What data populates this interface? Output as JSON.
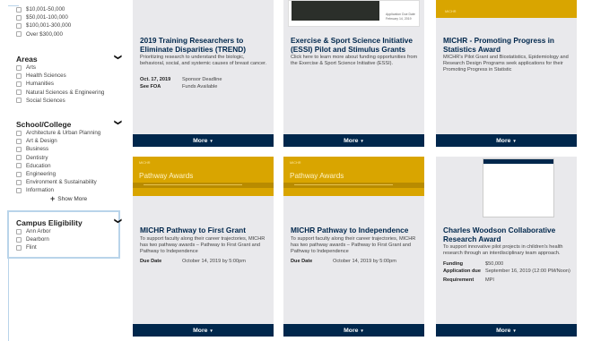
{
  "sidebar": {
    "amounts": [
      "$10,001-50,000",
      "$50,001-100,000",
      "$100,001-300,000",
      "Over $300,000"
    ],
    "areas": {
      "title": "Areas",
      "items": [
        "Arts",
        "Health Sciences",
        "Humanities",
        "Natural Sciences & Engineering",
        "Social Sciences"
      ]
    },
    "school": {
      "title": "School/College",
      "items": [
        "Architecture & Urban Planning",
        "Art & Design",
        "Business",
        "Dentistry",
        "Education",
        "Engineering",
        "Environment & Sustainability",
        "Information"
      ],
      "show_more": "Show More"
    },
    "campus": {
      "title": "Campus Eligibility",
      "items": [
        "Ann Arbor",
        "Dearborn",
        "Flint"
      ]
    }
  },
  "cards": [
    {
      "title": "2019 Training Researchers to Eliminate Disparities (TREND)",
      "desc": "Prioritizing research to understand the biologic, behavioral, social, and systemic causes of breast cancer.",
      "meta": [
        [
          "Oct. 17, 2019",
          "Sponsor Deadline"
        ],
        [
          "See FOA",
          "Funds Available"
        ]
      ],
      "more": "More"
    },
    {
      "title": "Exercise & Sport Science Initiative (ESSI) Pilot and Stimulus Grants",
      "desc": "Click here to learn more about funding opportunities from the Exercise & Sport Science Initiative (ESSI).",
      "thumb_caption": "Application Due Date\nFebruary 14, 2019",
      "more": "More"
    },
    {
      "title": "MICHR - Promoting Progress in Statistics Award",
      "desc": "MICHR's Pilot Grant and Biostatistics, Epidemiology and Research Design Programs seek applications for their Promoting Progress in Statistic",
      "more": "More"
    },
    {
      "banner_small": "MICHR",
      "banner_big": "Pathway Awards",
      "title": "MICHR Pathway to First Grant",
      "desc": "To support faculty along their career trajectories, MICHR has two pathway awards – Pathway to First Grant and Pathway to Independence",
      "meta": [
        [
          "Due Date",
          "October 14, 2019 by 5:00pm"
        ]
      ],
      "more": "More"
    },
    {
      "banner_small": "MICHR",
      "banner_big": "Pathway Awards",
      "title": "MICHR Pathway to Independence",
      "desc": "To support faculty along their career trajectories, MICHR has two pathway awards – Pathway to First Grant and Pathway to Independence",
      "meta": [
        [
          "Due Date",
          "October 14, 2019 by 5:00pm"
        ]
      ],
      "more": "More"
    },
    {
      "title": "Charles Woodson Collaborative Research Award",
      "desc": "To support innovative pilot projects in children's health research through an interdisciplinary team approach.",
      "meta": [
        [
          "Funding",
          "$50,000"
        ],
        [
          "Application due",
          "September 16, 2019 (12:00 PM/Noon)"
        ],
        [
          "Requirement",
          "MPI"
        ]
      ],
      "more": "More"
    }
  ],
  "colors": {
    "navy": "#00274c",
    "maize": "#d9a500",
    "card_bg": "#e9e9ec"
  }
}
